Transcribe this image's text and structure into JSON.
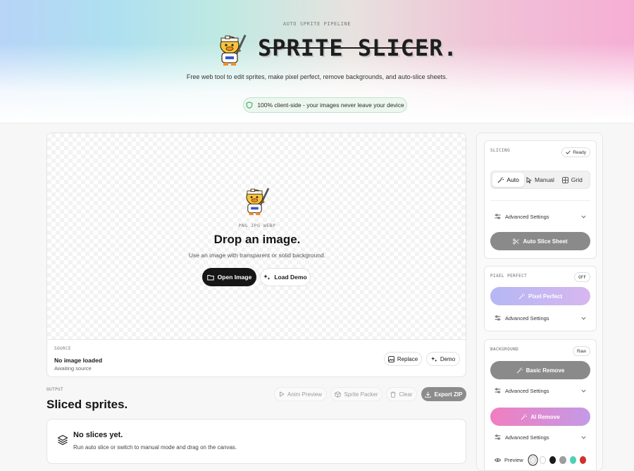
{
  "header": {
    "eyebrow": "AUTO SPRITE PIPELINE",
    "logo_text": "SPRITE SLICER.",
    "tagline": "Free web tool to edit sprites, make pixel perfect, remove backgrounds, and auto-slice sheets.",
    "privacy": "100% client-side - your images never leave your device"
  },
  "canvas": {
    "formats": "PNG JPG WEBP",
    "title": "Drop an image.",
    "subtitle": "Use an image with transparent or solid background.",
    "open_label": "Open Image",
    "demo_label": "Load Demo"
  },
  "source": {
    "label": "SOURCE",
    "name": "No image loaded",
    "status": "Awaiting source",
    "replace_label": "Replace",
    "demo_label": "Demo"
  },
  "output": {
    "label": "OUTPUT",
    "title": "Sliced sprites.",
    "anim_label": "Anim Preview",
    "packer_label": "Sprite Packer",
    "clear_label": "Clear",
    "export_label": "Export ZIP",
    "empty_title": "No slices yet.",
    "empty_sub": "Run auto slice or switch to manual mode and drag on the canvas."
  },
  "sidebar": {
    "slicing": {
      "label": "SLICING",
      "status": "Ready",
      "modes": [
        "Auto",
        "Manual",
        "Grid"
      ],
      "active_mode": "Auto",
      "advanced": "Advanced Settings",
      "action": "Auto Slice Sheet"
    },
    "pixel_perfect": {
      "label": "PIXEL PERFECT",
      "status": "OFF",
      "action": "Pixel Perfect",
      "advanced": "Advanced Settings"
    },
    "background": {
      "label": "BACKGROUND",
      "status": "Raw",
      "basic_action": "Basic Remove",
      "basic_advanced": "Advanced Settings",
      "ai_action": "AI Remove",
      "ai_advanced": "Advanced Settings",
      "preview_label": "Preview",
      "swatches": [
        "transparent",
        "#ffffff",
        "#1a1a1a",
        "#9e9e9e",
        "#4fd1b5",
        "#d32f2f"
      ]
    }
  },
  "colors": {
    "slice_button": "#8a8a8a",
    "pixel_perfect_gradient": [
      "#b5b7f5",
      "#d7b7ef"
    ],
    "ai_remove_gradient": [
      "#f07ec0",
      "#c49ae6"
    ],
    "privacy_bg": "#ecf7ef"
  }
}
